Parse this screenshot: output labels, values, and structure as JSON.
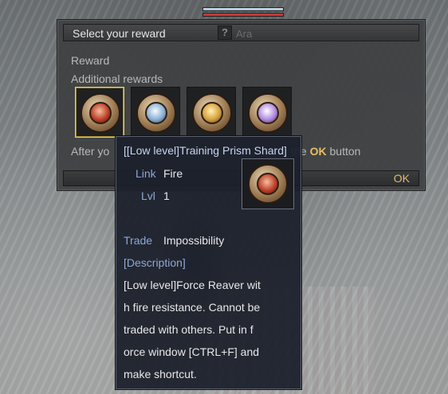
{
  "window": {
    "title": "Select your reward",
    "npc_name": "Ara",
    "help_symbol": "?",
    "reward_label": "Reward",
    "additional_label": "Additional rewards",
    "instruction_start": "After yo",
    "instruction_end": "the",
    "instruction_key": "OK",
    "instruction_tail": "button",
    "ok_label": "OK"
  },
  "rewards": [
    {
      "icon": "fire-prism-shard-icon",
      "selected": true
    },
    {
      "icon": "water-prism-shard-icon",
      "selected": false
    },
    {
      "icon": "light-prism-shard-icon",
      "selected": false
    },
    {
      "icon": "arcane-prism-shard-icon",
      "selected": false
    }
  ],
  "tooltip": {
    "name": "[[Low level]Training Prism Shard]",
    "link_key": "Link",
    "link_val": "Fire",
    "lvl_key": "Lvl",
    "lvl_val": "1",
    "trade_key": "Trade",
    "trade_val": "Impossibility",
    "desc_head": "[Description]",
    "desc_lines": [
      "[Low level]Force Reaver wit",
      "h fire resistance. Cannot be",
      " traded with others. Put in f",
      "orce window [CTRL+F] and",
      " make shortcut."
    ]
  },
  "colors": {
    "accent_ok": "#e8c060",
    "selected_border": "#e8d060",
    "tooltip_key": "#8ea6d6"
  }
}
